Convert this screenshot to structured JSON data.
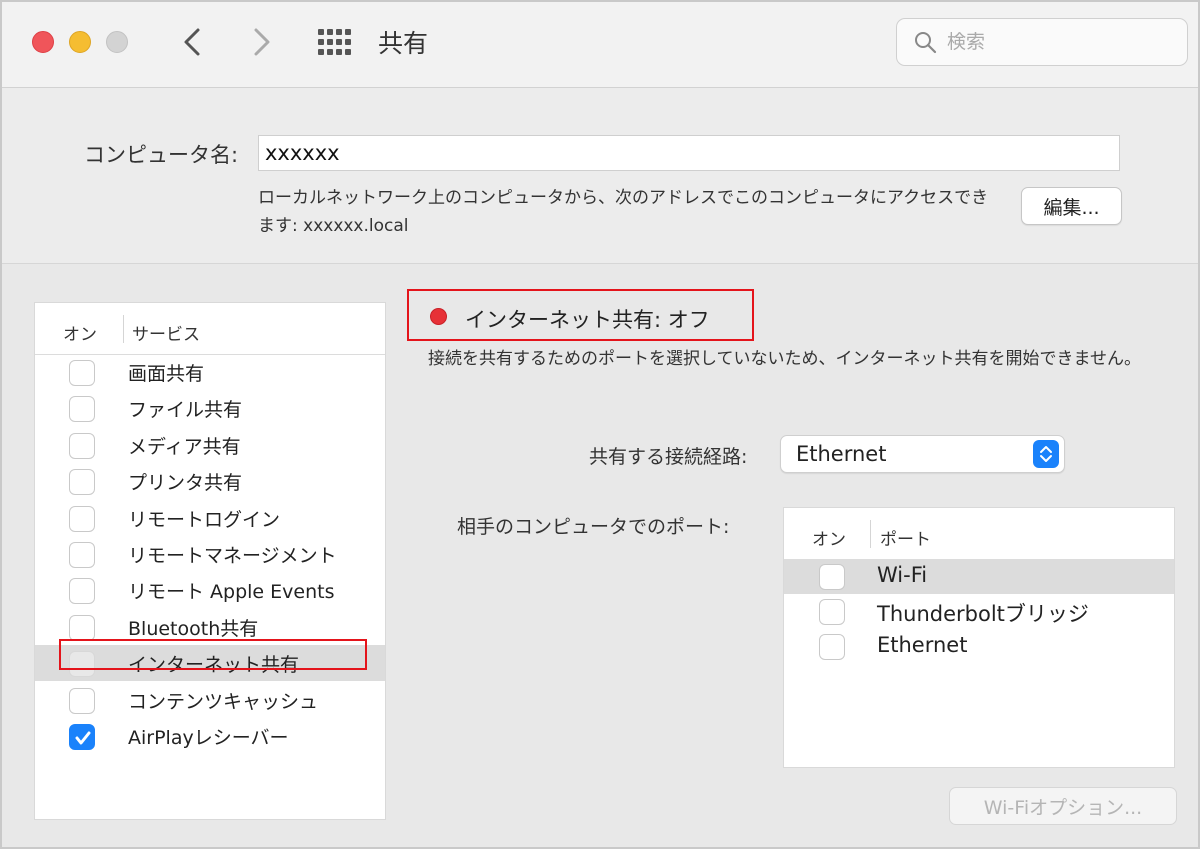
{
  "window": {
    "title": "共有"
  },
  "search": {
    "placeholder": "検索"
  },
  "computer_name": {
    "label": "コンピュータ名:",
    "value": "xxxxxx",
    "description": "ローカルネットワーク上のコンピュータから、次のアドレスでこのコンピュータにアクセスできます: xxxxxx.local",
    "edit_label": "編集..."
  },
  "services": {
    "col_on": "オン",
    "col_service": "サービス",
    "items": [
      {
        "label": "画面共有",
        "checked": false
      },
      {
        "label": "ファイル共有",
        "checked": false
      },
      {
        "label": "メディア共有",
        "checked": false
      },
      {
        "label": "プリンタ共有",
        "checked": false
      },
      {
        "label": "リモートログイン",
        "checked": false
      },
      {
        "label": "リモートマネージメント",
        "checked": false
      },
      {
        "label": "リモート Apple Events",
        "checked": false
      },
      {
        "label": "Bluetooth共有",
        "checked": false
      },
      {
        "label": "インターネット共有",
        "checked": false,
        "selected": true
      },
      {
        "label": "コンテンツキャッシュ",
        "checked": false
      },
      {
        "label": "AirPlayレシーバー",
        "checked": true
      }
    ]
  },
  "internet_sharing": {
    "status": "インターネット共有: オフ",
    "status_color": "#e73137",
    "description": "接続を共有するためのポートを選択していないため、インターネット共有を開始できません。",
    "share_from_label": "共有する接続経路:",
    "share_from_value": "Ethernet",
    "ports_label": "相手のコンピュータでのポート:",
    "ports_col_on": "オン",
    "ports_col_port": "ポート",
    "ports": [
      {
        "label": "Wi-Fi",
        "checked": false,
        "selected": true
      },
      {
        "label": "Thunderboltブリッジ",
        "checked": false
      },
      {
        "label": "Ethernet",
        "checked": false
      }
    ],
    "wifi_options_label": "Wi-Fiオプション..."
  },
  "colors": {
    "accent": "#1a82fb",
    "highlight": "#e4141b"
  }
}
